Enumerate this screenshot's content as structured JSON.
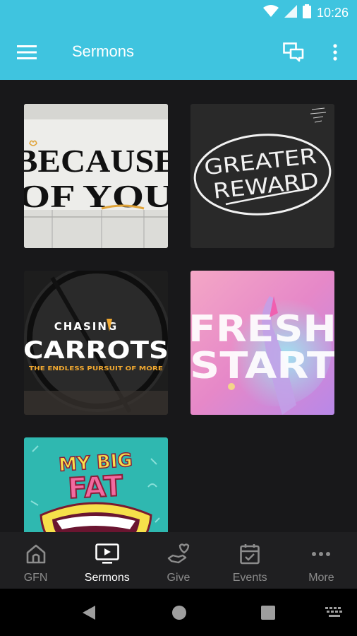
{
  "status_bar": {
    "time": "10:26",
    "icons": [
      "wifi-icon",
      "signal-icon",
      "battery-icon"
    ]
  },
  "app_bar": {
    "title": "Sermons",
    "background": "#3fc4df",
    "icons": [
      "menu-icon",
      "chat-icon",
      "overflow-icon"
    ]
  },
  "sermons": [
    {
      "title_lines": [
        "BECAUSE",
        "OF YOU"
      ]
    },
    {
      "title_lines": [
        "GREATER",
        "REWARD"
      ]
    },
    {
      "title_top": "CHASING",
      "title_main": "CARROTS",
      "subtitle": "THE ENDLESS PURSUIT OF MORE"
    },
    {
      "title_lines": [
        "FRESH",
        "START"
      ]
    },
    {
      "title_lines": [
        "MY BIG",
        "FAT"
      ]
    }
  ],
  "bottom_nav": {
    "items": [
      {
        "label": "GFN",
        "icon": "church-icon",
        "active": false
      },
      {
        "label": "Sermons",
        "icon": "tv-play-icon",
        "active": true
      },
      {
        "label": "Give",
        "icon": "give-heart-icon",
        "active": false
      },
      {
        "label": "Events",
        "icon": "calendar-icon",
        "active": false
      },
      {
        "label": "More",
        "icon": "more-dots-icon",
        "active": false
      }
    ]
  },
  "system_nav": {
    "icons": [
      "back-icon",
      "home-icon",
      "recents-icon",
      "keyboard-icon"
    ]
  }
}
